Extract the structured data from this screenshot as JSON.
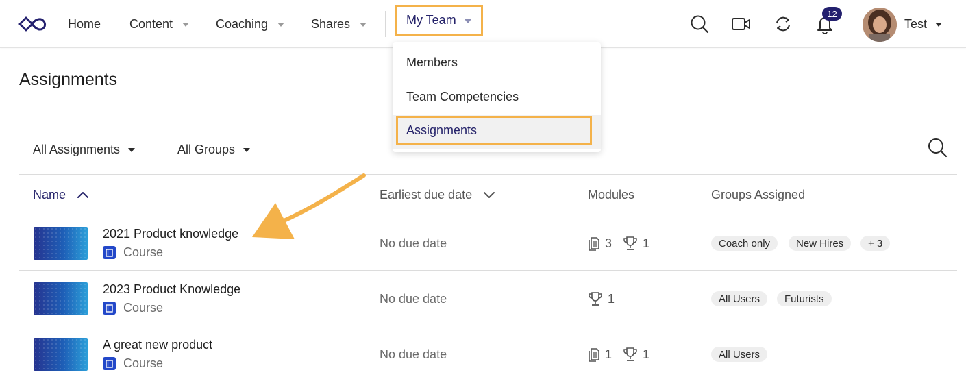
{
  "nav": {
    "home": "Home",
    "content": "Content",
    "coaching": "Coaching",
    "shares": "Shares",
    "my_team": "My Team",
    "notification_count": "12",
    "user_name": "Test"
  },
  "dropdown": {
    "items": [
      "Members",
      "Team Competencies",
      "Assignments"
    ]
  },
  "page": {
    "title": "Assignments",
    "filters": [
      "All Assignments",
      "All Groups"
    ]
  },
  "table": {
    "columns": {
      "name": "Name",
      "due": "Earliest due date",
      "modules": "Modules",
      "groups": "Groups Assigned"
    },
    "rows": [
      {
        "title": "2021 Product knowledge",
        "type": "Course",
        "due": "No due date",
        "docs": "3",
        "trophies": "1",
        "groups": [
          "Coach only",
          "New Hires",
          "+ 3"
        ]
      },
      {
        "title": "2023 Product Knowledge",
        "type": "Course",
        "due": "No due date",
        "docs": "",
        "trophies": "1",
        "groups": [
          "All Users",
          "Futurists"
        ]
      },
      {
        "title": "A great new product",
        "type": "Course",
        "due": "No due date",
        "docs": "1",
        "trophies": "1",
        "groups": [
          "All Users"
        ]
      }
    ]
  },
  "colors": {
    "accent": "#25236a",
    "highlight": "#f4b24a",
    "badge": "#23206e"
  }
}
